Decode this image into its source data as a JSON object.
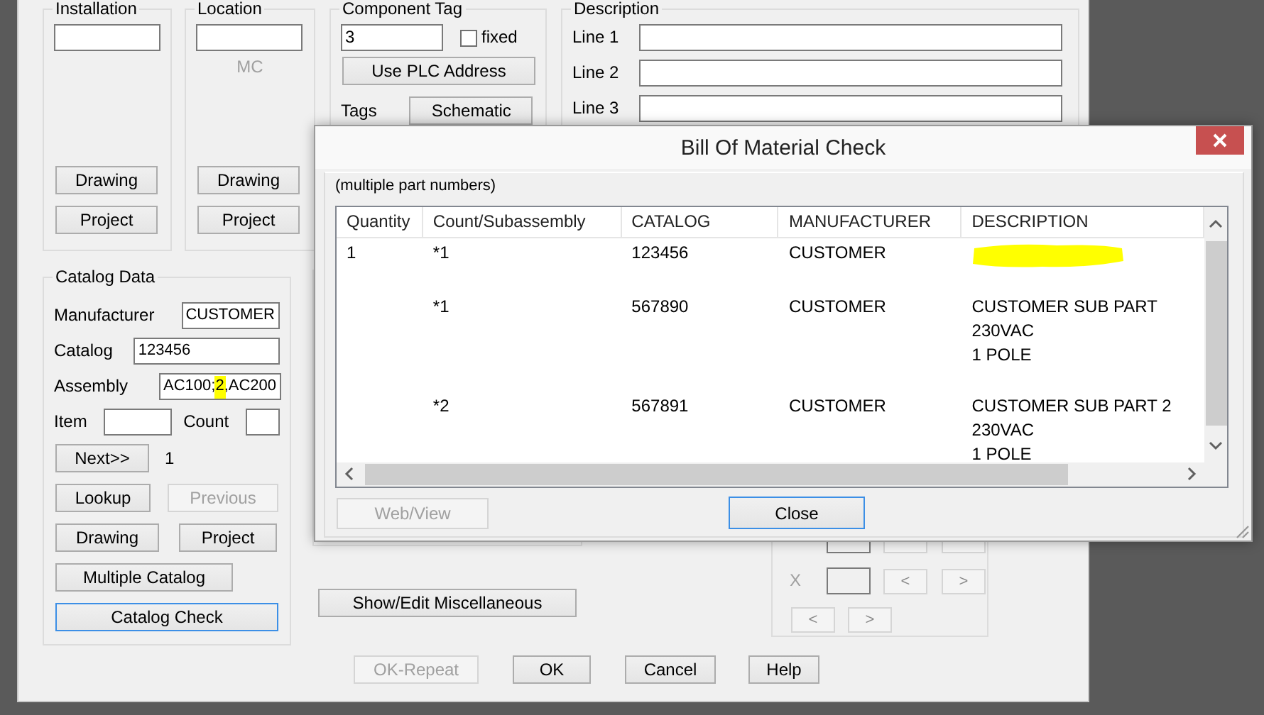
{
  "installation": {
    "title": "Installation",
    "buttons": [
      "Drawing",
      "Project"
    ]
  },
  "location": {
    "title": "Location",
    "sublabel": "MC",
    "buttons": [
      "Drawing",
      "Project"
    ]
  },
  "component_tag": {
    "title": "Component Tag",
    "value": "3",
    "fixed": {
      "label": "fixed",
      "checked": false
    },
    "plc_button": "Use PLC Address",
    "tags_label": "Tags",
    "schematic_button": "Schematic"
  },
  "description": {
    "title": "Description",
    "lines": [
      "Line 1",
      "Line 2",
      "Line 3"
    ]
  },
  "catalog_data": {
    "title": "Catalog Data",
    "manufacturer": {
      "label": "Manufacturer",
      "value": "CUSTOMER"
    },
    "catalog": {
      "label": "Catalog",
      "value": "123456"
    },
    "assembly": {
      "label": "Assembly",
      "value": "AC100;2,AC200",
      "highlighted": true
    },
    "item": {
      "label": "Item"
    },
    "count": {
      "label": "Count"
    },
    "next_button": "Next>>",
    "next_count": "1",
    "buttons": [
      {
        "label": "Lookup",
        "disabled": false,
        "focused": false
      },
      {
        "label": "Previous",
        "disabled": true,
        "focused": false
      },
      {
        "label": "Drawing",
        "disabled": false,
        "focused": false
      },
      {
        "label": "Project",
        "disabled": false,
        "focused": false
      },
      {
        "label": "Multiple Catalog",
        "disabled": false,
        "focused": false
      },
      {
        "label": "Catalog Check",
        "disabled": false,
        "focused": true
      }
    ]
  },
  "misc_button": "Show/Edit Miscellaneous",
  "nav_controls": {
    "x_label": "X",
    "row_1": [
      "<",
      ">"
    ],
    "row_2": [
      "<",
      ">"
    ]
  },
  "footer_buttons": [
    {
      "label": "OK-Repeat",
      "disabled": true
    },
    {
      "label": "OK",
      "disabled": false
    },
    {
      "label": "Cancel",
      "disabled": false
    },
    {
      "label": "Help",
      "disabled": false
    }
  ],
  "dialog": {
    "title": "Bill Of Material Check",
    "group_label": "(multiple part numbers)",
    "columns": [
      "Quantity",
      "Count/Subassembly",
      "CATALOG",
      "MANUFACTURER",
      "DESCRIPTION"
    ],
    "rows": [
      {
        "quantity": "1",
        "count": "*1",
        "catalog": "123456",
        "manufacturer": "CUSTOMER",
        "redacted": true
      },
      {
        "count": "*1",
        "catalog": "567890",
        "manufacturer": "CUSTOMER",
        "description_lines": [
          "CUSTOMER SUB PART",
          "230VAC",
          "1 POLE"
        ],
        "redacted": false
      },
      {
        "count": "*2",
        "catalog": "567891",
        "manufacturer": "CUSTOMER",
        "description_lines": [
          "CUSTOMER SUB PART 2",
          "230VAC",
          "1 POLE"
        ],
        "redacted": false
      }
    ],
    "buttons": [
      {
        "label": "Web/View",
        "disabled": true,
        "focused": false
      },
      {
        "label": "Close",
        "disabled": false,
        "focused": true
      }
    ]
  }
}
